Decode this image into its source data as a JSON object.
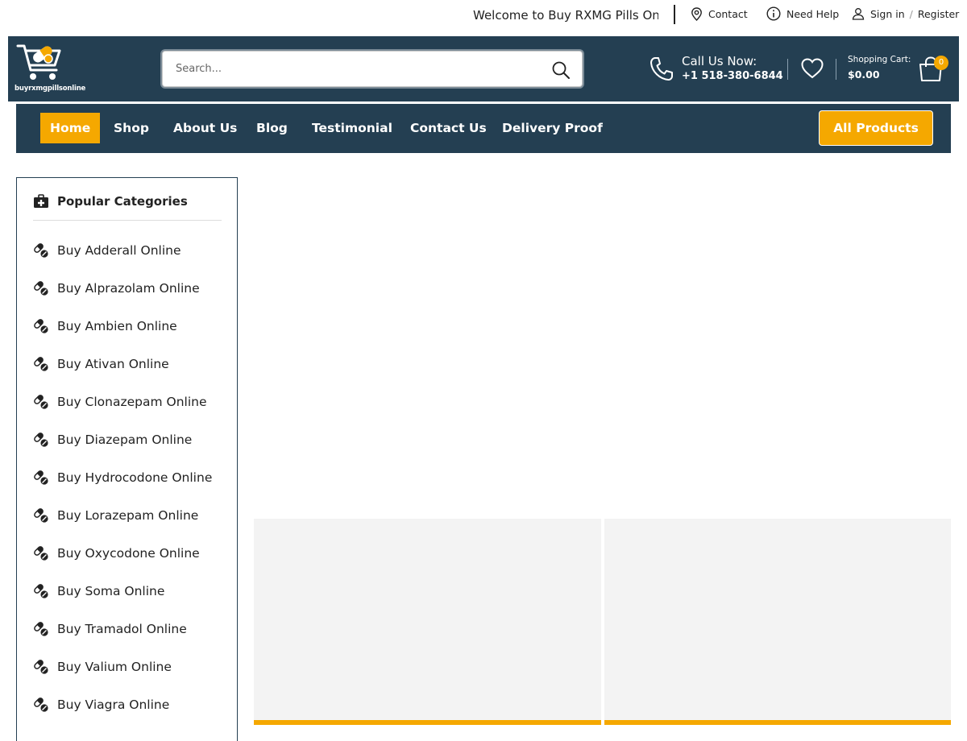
{
  "topbar": {
    "welcome": "Welcome to Buy RXMG Pills Online",
    "contact": "Contact",
    "help": "Need Help",
    "signin": "Sign in",
    "register": "Register"
  },
  "header": {
    "logo_text": "buyrxmgpillsonline",
    "search_placeholder": "Search...",
    "call_label": "Call Us Now:",
    "call_number": "+1 518-380-6844",
    "cart_label": "Shopping Cart:",
    "cart_total": "$0.00",
    "cart_count": "0"
  },
  "nav": {
    "items": [
      {
        "label": "Home"
      },
      {
        "label": "Shop"
      },
      {
        "label": "About Us"
      },
      {
        "label": "Blog"
      },
      {
        "label": "Testimonial"
      },
      {
        "label": "Contact Us"
      },
      {
        "label": "Delivery Proof"
      }
    ],
    "all_products": "All Products"
  },
  "sidebar": {
    "title": "Popular Categories",
    "categories": [
      "Buy Adderall Online",
      "Buy Alprazolam Online",
      "Buy Ambien Online",
      "Buy Ativan Online",
      "Buy Clonazepam Online",
      "Buy Diazepam Online",
      "Buy Hydrocodone Online",
      "Buy Lorazepam Online",
      "Buy Oxycodone Online",
      "Buy Soma Online",
      "Buy Tramadol Online",
      "Buy Valium Online",
      "Buy Viagra Online"
    ]
  },
  "colors": {
    "brand_navy": "#243f52",
    "accent_orange": "#f5a800"
  }
}
